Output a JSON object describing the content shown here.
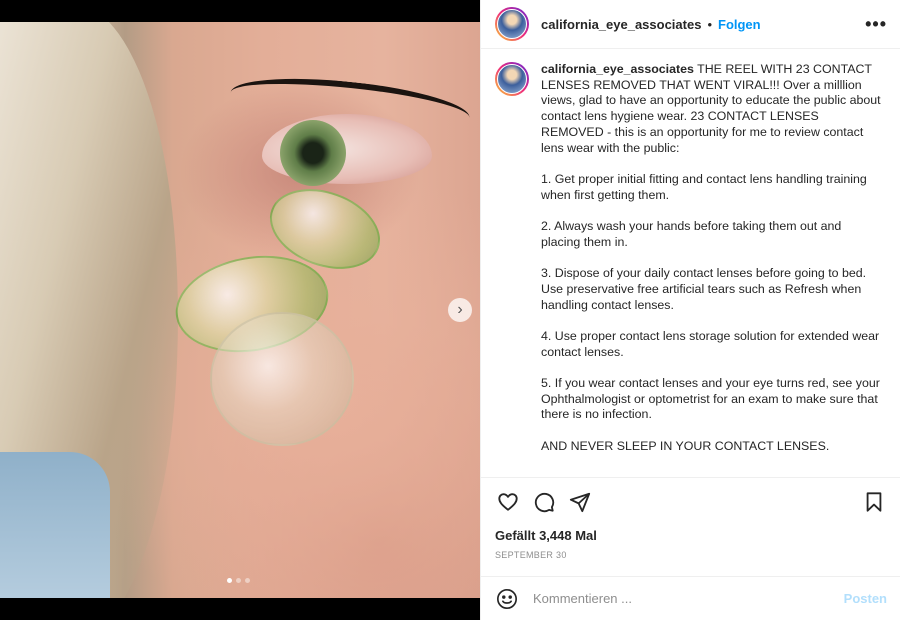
{
  "post": {
    "username": "california_eye_associates",
    "separator": "•",
    "follow_label": "Folgen",
    "more_icon": "•••",
    "caption_text": " THE REEL WITH 23 CONTACT LENSES REMOVED THAT WENT VIRAL!!! Over a milllion views, glad to have an opportunity to educate the public about contact lens hygiene wear. 23 CONTACT LENSES REMOVED - this is an opportunity for me to review contact lens wear with the public:\n\n1. Get proper initial fitting and contact lens handling training when first getting them.\n\n2. Always wash your hands before taking them out and placing them in.\n\n3. Dispose of your daily contact lenses before going to bed. Use preservative free artificial tears such as Refresh when handling contact lenses.\n\n4. Use proper contact lens storage solution for extended wear contact lenses.\n\n5. If you wear contact lenses and your eye turns red, see your Ophthalmologist or optometrist for an exam to make sure that there is no infection.\n\nAND NEVER SLEEP IN YOUR CONTACT LENSES.",
    "likes_label": "Gefällt 3,448 Mal",
    "date_label": "SEPTEMBER 30"
  },
  "carousel": {
    "next_icon": "›",
    "slide_count": 3,
    "active_slide": 1
  },
  "comment": {
    "placeholder": "Kommentieren ...",
    "post_label": "Posten"
  },
  "icons": {
    "like": "heart-icon",
    "comment": "comment-icon",
    "share": "paper-plane-icon",
    "save": "bookmark-icon",
    "emoji": "smiley-icon"
  },
  "colors": {
    "link": "#0095f6",
    "post_disabled": "#b2dffc",
    "muted": "#8e8e8e"
  }
}
